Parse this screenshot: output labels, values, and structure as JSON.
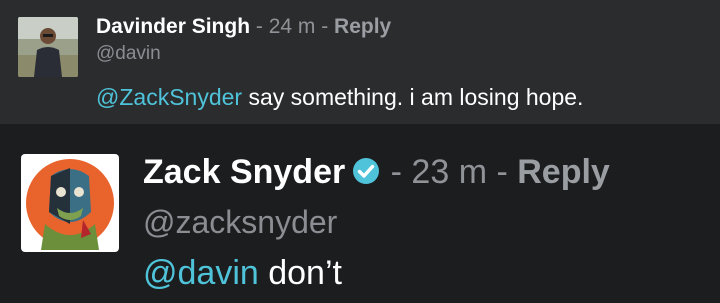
{
  "comments": [
    {
      "author": "Davinder Singh",
      "time": " - 24 m - ",
      "reply": "Reply",
      "handle": "@davin",
      "mention": "@ZackSnyder",
      "text": " say something. i am losing hope.",
      "avatar": "user-photo-avatar"
    },
    {
      "author": "Zack Snyder",
      "verified": true,
      "time": " - 23 m - ",
      "reply": "Reply",
      "handle": "@zacksnyder",
      "mention": "@davin",
      "text": " don’t",
      "avatar": "illustrated-zombie-avatar"
    }
  ],
  "colors": {
    "mention": "#4fc3d9",
    "verified_badge": "#4fc3d9",
    "background_top": "#2b2c2e",
    "background_bottom": "#1c1d1f"
  }
}
